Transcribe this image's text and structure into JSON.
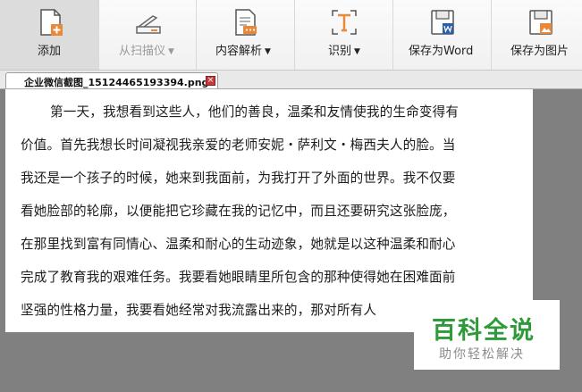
{
  "toolbar": {
    "items": [
      {
        "label": "添加",
        "icon": "add-document-icon",
        "has_caret": false
      },
      {
        "label": "从扫描仪",
        "icon": "scanner-icon",
        "has_caret": true
      },
      {
        "label": "内容解析",
        "icon": "content-parse-icon",
        "has_caret": true
      },
      {
        "label": "识别",
        "icon": "text-recognize-icon",
        "has_caret": true
      },
      {
        "label": "保存为Word",
        "icon": "save-word-icon",
        "has_caret": false
      },
      {
        "label": "保存为图片",
        "icon": "save-image-icon",
        "has_caret": false
      }
    ],
    "caret": "▼"
  },
  "tab": {
    "title": "企业微信截图_15124465193394.png",
    "close": "×"
  },
  "document": {
    "lines": [
      "第一天，我想看到这些人，他们的善良，温柔和友情使我的生命变得有",
      "价值。首先我想长时间凝视我亲爱的老师安妮・萨利文・梅西夫人的脸。当",
      "我还是一个孩子的时候，她来到我面前，为我打开了外面的世界。我不仅要",
      "看她脸部的轮廓，以便能把它珍藏在我的记忆中，而且还要研究这张脸庞，",
      "在那里找到富有同情心、温柔和耐心的生动迹象，她就是以这种温柔和耐心",
      "完成了教育我的艰难任务。我要看她眼睛里所包含的那种使得她在困难面前",
      "坚强的性格力量，我要看她经常对我流露出来的，那对所有人"
    ]
  },
  "watermark": {
    "main": "百科全说",
    "sub": "助你轻松解决"
  },
  "colors": {
    "accent_orange": "#e8893a",
    "word_blue": "#2b5faa",
    "watermark_green": "#2e9a3a",
    "viewer_gray": "#808080"
  }
}
